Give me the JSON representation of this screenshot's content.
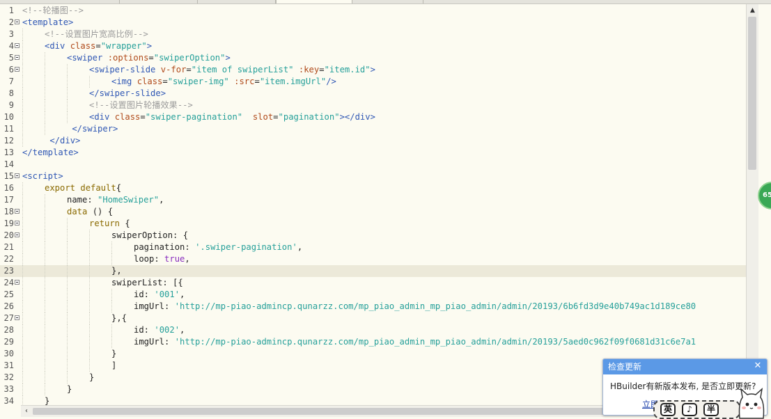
{
  "popup": {
    "title": "检查更新",
    "message": "HBuilder有新版本发布, 是否立即更新?",
    "link": "立即",
    "close": "✕"
  },
  "badge": {
    "text": "65"
  },
  "ime": {
    "k1": "英",
    "k2": "♪",
    "k3": "半"
  },
  "editor": {
    "current_line": 23,
    "lines": [
      {
        "n": "1",
        "fold": false,
        "indent": 0,
        "segs": [
          [
            "c-com",
            "<!--轮播图-->"
          ]
        ]
      },
      {
        "n": "2",
        "fold": true,
        "indent": 0,
        "segs": [
          [
            "c-tag",
            "<template>"
          ]
        ]
      },
      {
        "n": "3",
        "fold": false,
        "indent": 1,
        "segs": [
          [
            "c-com",
            "<!--设置图片宽高比例-->"
          ]
        ]
      },
      {
        "n": "4",
        "fold": true,
        "indent": 1,
        "segs": [
          [
            "c-tag",
            "<div "
          ],
          [
            "c-attr",
            "class"
          ],
          [
            "c-txt",
            "="
          ],
          [
            "c-str",
            "\"wrapper\""
          ],
          [
            "c-tag",
            ">"
          ]
        ]
      },
      {
        "n": "5",
        "fold": true,
        "indent": 2,
        "segs": [
          [
            "c-tag",
            "<swiper "
          ],
          [
            "c-attr",
            ":options"
          ],
          [
            "c-txt",
            "="
          ],
          [
            "c-str",
            "\"swiperOption\""
          ],
          [
            "c-tag",
            ">"
          ]
        ]
      },
      {
        "n": "6",
        "fold": true,
        "indent": 3,
        "segs": [
          [
            "c-tag",
            "<swiper-slide "
          ],
          [
            "c-attr",
            "v-for"
          ],
          [
            "c-txt",
            "="
          ],
          [
            "c-str",
            "\"item of swiperList\" "
          ],
          [
            "c-attr",
            ":key"
          ],
          [
            "c-txt",
            "="
          ],
          [
            "c-str",
            "\"item.id\""
          ],
          [
            "c-tag",
            ">"
          ]
        ]
      },
      {
        "n": "7",
        "fold": false,
        "indent": 4,
        "segs": [
          [
            "c-tag",
            "<img "
          ],
          [
            "c-attr",
            "class"
          ],
          [
            "c-txt",
            "="
          ],
          [
            "c-str",
            "\"swiper-img\" "
          ],
          [
            "c-attr",
            ":src"
          ],
          [
            "c-txt",
            "="
          ],
          [
            "c-str",
            "\"item.imgUrl\""
          ],
          [
            "c-tag",
            "/>"
          ]
        ]
      },
      {
        "n": "8",
        "fold": false,
        "indent": 3,
        "segs": [
          [
            "c-tag",
            "</swiper-slide>"
          ]
        ]
      },
      {
        "n": "9",
        "fold": false,
        "indent": 3,
        "segs": [
          [
            "c-com",
            "<!--设置图片轮播效果-->"
          ]
        ]
      },
      {
        "n": "10",
        "fold": false,
        "indent": 3,
        "segs": [
          [
            "c-tag",
            "<div "
          ],
          [
            "c-attr",
            "class"
          ],
          [
            "c-txt",
            "="
          ],
          [
            "c-str",
            "\"swiper-pagination\"  "
          ],
          [
            "c-attr",
            "slot"
          ],
          [
            "c-txt",
            "="
          ],
          [
            "c-str",
            "\"pagination\""
          ],
          [
            "c-tag",
            "></div>"
          ]
        ]
      },
      {
        "n": "11",
        "fold": false,
        "indent": 2,
        "pre": " ",
        "segs": [
          [
            "c-tag",
            "</swiper>"
          ]
        ]
      },
      {
        "n": "12",
        "fold": false,
        "indent": 1,
        "pre": " ",
        "segs": [
          [
            "c-tag",
            "</div>"
          ]
        ]
      },
      {
        "n": "13",
        "fold": false,
        "indent": 0,
        "segs": [
          [
            "c-tag",
            "</template>"
          ]
        ]
      },
      {
        "n": "14",
        "fold": false,
        "indent": 0,
        "segs": []
      },
      {
        "n": "15",
        "fold": true,
        "indent": 0,
        "segs": [
          [
            "c-tag",
            "<script>"
          ]
        ]
      },
      {
        "n": "16",
        "fold": false,
        "indent": 1,
        "segs": [
          [
            "c-kw",
            "export default"
          ],
          [
            "c-txt",
            "{"
          ]
        ]
      },
      {
        "n": "17",
        "fold": false,
        "indent": 2,
        "segs": [
          [
            "c-txt",
            "name: "
          ],
          [
            "c-str",
            "\"HomeSwiper\""
          ],
          [
            "c-txt",
            ","
          ]
        ]
      },
      {
        "n": "18",
        "fold": true,
        "indent": 2,
        "segs": [
          [
            "c-kw",
            "data"
          ],
          [
            "c-txt",
            " () {"
          ]
        ]
      },
      {
        "n": "19",
        "fold": true,
        "indent": 3,
        "segs": [
          [
            "c-kw",
            "return"
          ],
          [
            "c-txt",
            " {"
          ]
        ]
      },
      {
        "n": "20",
        "fold": true,
        "indent": 4,
        "segs": [
          [
            "c-txt",
            "swiperOption: {"
          ]
        ]
      },
      {
        "n": "21",
        "fold": false,
        "indent": 5,
        "segs": [
          [
            "c-txt",
            "pagination: "
          ],
          [
            "c-str",
            "'.swiper-pagination'"
          ],
          [
            "c-txt",
            ","
          ]
        ]
      },
      {
        "n": "22",
        "fold": false,
        "indent": 5,
        "segs": [
          [
            "c-txt",
            "loop: "
          ],
          [
            "c-bool",
            "true"
          ],
          [
            "c-txt",
            ","
          ]
        ]
      },
      {
        "n": "23",
        "fold": false,
        "indent": 4,
        "segs": [
          [
            "c-txt",
            "},"
          ]
        ]
      },
      {
        "n": "24",
        "fold": true,
        "indent": 4,
        "segs": [
          [
            "c-txt",
            "swiperList: [{"
          ]
        ]
      },
      {
        "n": "25",
        "fold": false,
        "indent": 5,
        "segs": [
          [
            "c-txt",
            "id: "
          ],
          [
            "c-str",
            "'001'"
          ],
          [
            "c-txt",
            ","
          ]
        ]
      },
      {
        "n": "26",
        "fold": false,
        "indent": 5,
        "segs": [
          [
            "c-txt",
            "imgUrl: "
          ],
          [
            "c-str",
            "'http://mp-piao-admincp.qunarzz.com/mp_piao_admin_mp_piao_admin/admin/20193/6b6fd3d9e40b749ac1d189ce80"
          ]
        ]
      },
      {
        "n": "27",
        "fold": true,
        "indent": 4,
        "segs": [
          [
            "c-txt",
            "},{"
          ]
        ]
      },
      {
        "n": "28",
        "fold": false,
        "indent": 5,
        "segs": [
          [
            "c-txt",
            "id: "
          ],
          [
            "c-str",
            "'002'"
          ],
          [
            "c-txt",
            ","
          ]
        ]
      },
      {
        "n": "29",
        "fold": false,
        "indent": 5,
        "segs": [
          [
            "c-txt",
            "imgUrl: "
          ],
          [
            "c-str",
            "'http://mp-piao-admincp.qunarzz.com/mp_piao_admin_mp_piao_admin/admin/20193/5aed0c962f09f0681d31c6e7a1"
          ]
        ]
      },
      {
        "n": "30",
        "fold": false,
        "indent": 4,
        "segs": [
          [
            "c-txt",
            "}"
          ]
        ]
      },
      {
        "n": "31",
        "fold": false,
        "indent": 4,
        "segs": [
          [
            "c-txt",
            "]"
          ]
        ]
      },
      {
        "n": "32",
        "fold": false,
        "indent": 3,
        "segs": [
          [
            "c-txt",
            "}"
          ]
        ]
      },
      {
        "n": "33",
        "fold": false,
        "indent": 2,
        "segs": [
          [
            "c-txt",
            "}"
          ]
        ]
      },
      {
        "n": "34",
        "fold": false,
        "indent": 1,
        "segs": [
          [
            "c-txt",
            "}"
          ]
        ]
      }
    ]
  }
}
